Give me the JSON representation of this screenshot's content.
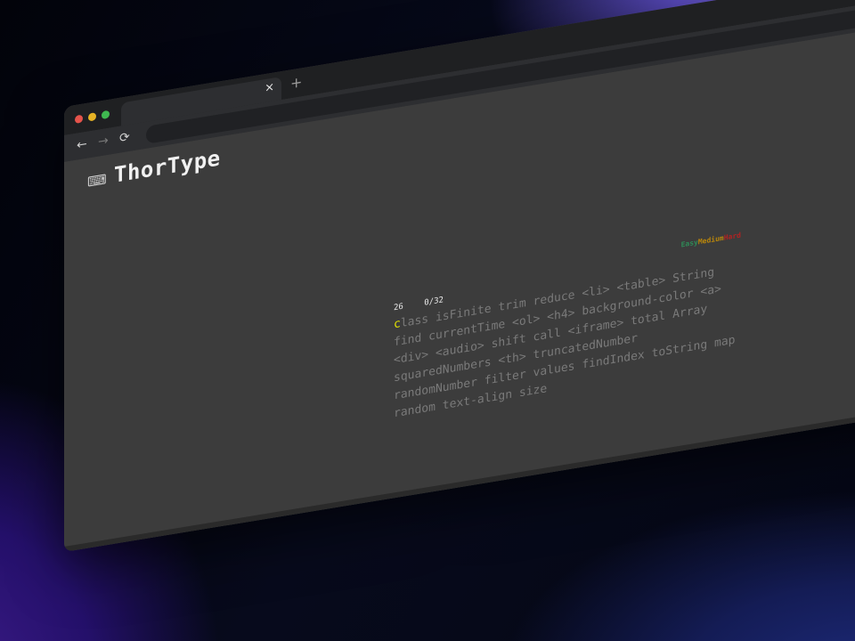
{
  "browser": {
    "tab_close": "×",
    "new_tab": "+",
    "back": "←",
    "forward": "→",
    "reload": "⟳"
  },
  "app": {
    "title": "ThorType",
    "logo_icon": "typewriter-icon"
  },
  "stats": {
    "wpm": "26",
    "progress": "0/32"
  },
  "difficulty": {
    "easy": "Easy",
    "medium": "Medium",
    "hard": "Hard"
  },
  "words": {
    "typed": "c",
    "remaining": "lass isFinite trim reduce <li> <table> String\nfind currentTime <ol> <h4> background-color <a>\n<div> <audio> shift call <iframe> total Array\nsquaredNumbers <th> truncatedNumber\nrandomNumber filter values findIndex toString map\nrandom text-align size"
  },
  "colors": {
    "typed": "#e6e600",
    "untyped": "#7a7a7a",
    "easy": "#2e8b57",
    "medium": "#b8860b",
    "hard": "#b22222"
  }
}
